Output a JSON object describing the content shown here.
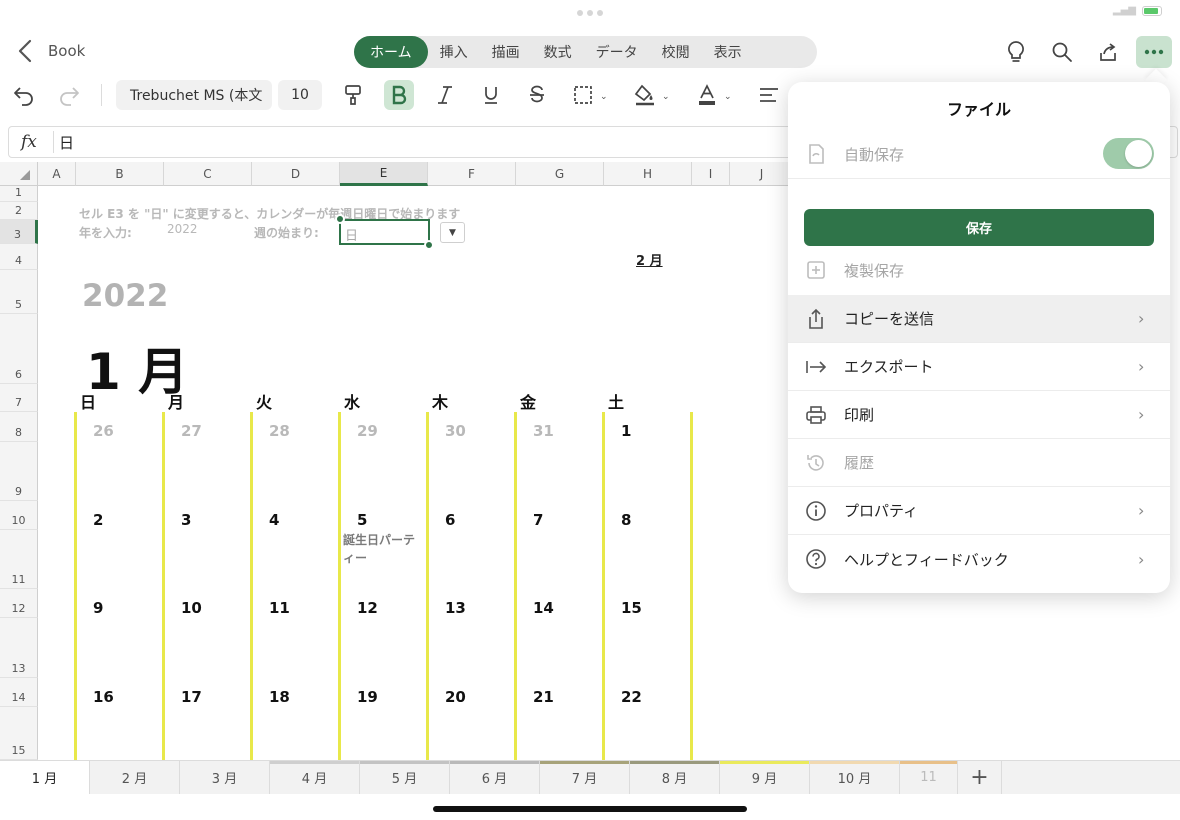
{
  "app": {
    "back_label": "Book"
  },
  "ribbon": {
    "tabs": [
      {
        "label": "ホーム",
        "active": true
      },
      {
        "label": "挿入"
      },
      {
        "label": "描画"
      },
      {
        "label": "数式"
      },
      {
        "label": "データ"
      },
      {
        "label": "校閲"
      },
      {
        "label": "表示"
      }
    ]
  },
  "toolbar": {
    "font_name": "Trebuchet MS (本文",
    "font_size": "10",
    "icons": [
      "undo-icon",
      "redo-icon",
      "format-painter-icon",
      "bold-icon",
      "italic-icon",
      "underline-icon",
      "strikethrough-icon",
      "borders-icon",
      "fill-color-icon",
      "font-color-icon",
      "align-icon"
    ],
    "accent": "#2f7449"
  },
  "formula_bar": {
    "fx": "fx",
    "value": "日"
  },
  "grid": {
    "columns": [
      "A",
      "B",
      "C",
      "D",
      "E",
      "F",
      "G",
      "H",
      "I",
      "J"
    ],
    "selected_column": "E",
    "rows": [
      "1",
      "2",
      "3",
      "4",
      "5",
      "6",
      "7",
      "8",
      "9",
      "10",
      "11",
      "12",
      "13",
      "14",
      "15"
    ],
    "selected_row": "3"
  },
  "sheet": {
    "note": "セル E3 を \"日\" に変更すると、カレンダーが毎週日曜日で始まります",
    "year_label": "年を入力:",
    "year_value": "2022",
    "week_start_label": "週の始まり:",
    "week_start_value": "日",
    "feb_label": "2 月",
    "year_big": "2022",
    "month_title": "1 月",
    "weekdays": [
      "日",
      "月",
      "火",
      "水",
      "木",
      "金",
      "土"
    ],
    "weeks": [
      [
        "26",
        "27",
        "28",
        "29",
        "30",
        "31",
        "1"
      ],
      [
        "2",
        "3",
        "4",
        "5",
        "6",
        "7",
        "8"
      ],
      [
        "9",
        "10",
        "11",
        "12",
        "13",
        "14",
        "15"
      ],
      [
        "16",
        "17",
        "18",
        "19",
        "20",
        "21",
        "22"
      ]
    ],
    "event": "誕生日パーティー",
    "line_color": "#e8e84a"
  },
  "sheet_tabs": {
    "tabs": [
      "1 月",
      "2 月",
      "3 月",
      "4 月",
      "5 月",
      "6 月",
      "7 月",
      "8 月",
      "9 月",
      "10 月",
      "11"
    ],
    "active": "1 月",
    "add_label": "+"
  },
  "file_menu": {
    "title": "ファイル",
    "autosave_label": "自動保存",
    "autosave_on": true,
    "save_button": "保存",
    "items": [
      {
        "label": "複製保存",
        "icon": "duplicate-save-icon",
        "disabled": true,
        "chevron": false
      },
      {
        "label": "コピーを送信",
        "icon": "share-icon",
        "disabled": false,
        "chevron": true,
        "highlighted": true
      },
      {
        "label": "エクスポート",
        "icon": "export-icon",
        "disabled": false,
        "chevron": true
      },
      {
        "label": "印刷",
        "icon": "printer-icon",
        "disabled": false,
        "chevron": true
      },
      {
        "label": "履歴",
        "icon": "history-icon",
        "disabled": true,
        "chevron": false
      },
      {
        "label": "プロパティ",
        "icon": "info-icon",
        "disabled": false,
        "chevron": true
      },
      {
        "label": "ヘルプとフィードバック",
        "icon": "help-icon",
        "disabled": false,
        "chevron": true
      }
    ]
  }
}
